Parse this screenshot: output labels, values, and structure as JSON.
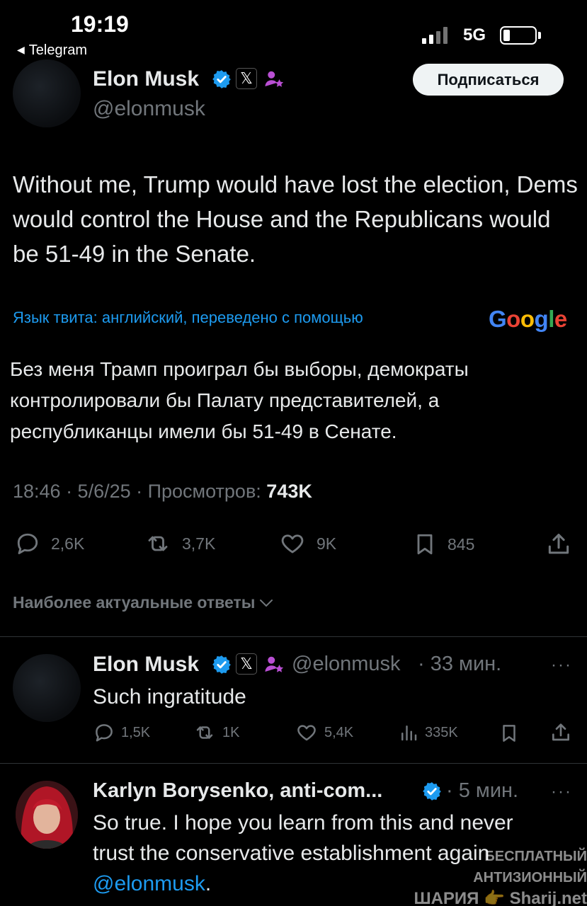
{
  "status_bar": {
    "time": "19:19",
    "back_app": "Telegram",
    "network": "5G"
  },
  "author": {
    "name": "Elon Musk",
    "handle": "@elonmusk",
    "follow_label": "Подписаться"
  },
  "tweet": {
    "text": "Without me, Trump would have lost the election, Dems would control the House and the Republicans would be 51-49 in the Senate.",
    "translation_note": "Язык твита: английский, переведено с помощью",
    "translation_provider": "Google",
    "translated_text": "Без меня Трамп проиграл бы выборы, демократы контролировали бы Палату представителей, а республиканцы имели бы 51-49 в Сенате.",
    "time_date": "18:46 · 5/6/25 · Просмотров: ",
    "views": "743K",
    "actions": {
      "replies": "2,6K",
      "reposts": "3,7K",
      "likes": "9K",
      "bookmarks": "845"
    }
  },
  "replies_header": "Наиболее актуальные ответы",
  "replies": [
    {
      "name": "Elon Musk",
      "handle": "@elonmusk",
      "time": "· 33 мин.",
      "text": "Such ingratitude",
      "actions": {
        "replies": "1,5K",
        "reposts": "1K",
        "likes": "5,4K",
        "views": "335K"
      }
    },
    {
      "name": "Karlyn Borysenko, anti-com...",
      "time": "· 5 мин.",
      "text_line1": "So true. I hope you learn from this and never",
      "text_line2": "trust the conservative establishment again",
      "mention": "@elonmusk",
      "period": "."
    }
  ],
  "watermark": {
    "line1": "БЕСПЛАТНЫЙ АНТИЗИОННЫЙ",
    "line2": "ШАРИЯ 👉 Sharij.net"
  },
  "colors": {
    "accent": "#1d9bf0",
    "text": "#e7e9ea",
    "muted": "#71767b",
    "affiliation": "#b94fd3"
  }
}
